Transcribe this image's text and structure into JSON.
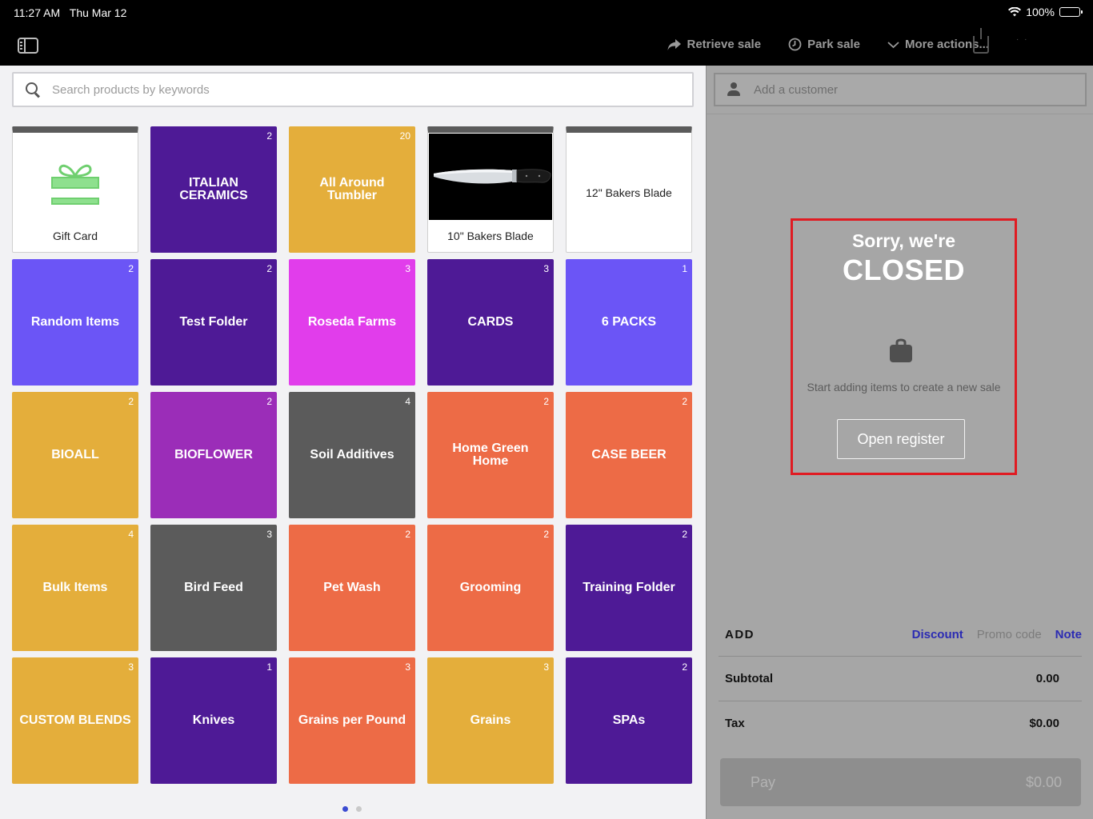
{
  "status_bar": {
    "time": "11:27 AM",
    "date": "Thu Mar 12",
    "battery": "100%"
  },
  "top_nav": {
    "retrieve_sale": "Retrieve sale",
    "park_sale": "Park sale",
    "more_actions": "More actions..."
  },
  "search": {
    "placeholder": "Search products by keywords"
  },
  "tiles": [
    {
      "label": "Gift Card",
      "type": "product",
      "icon": "gift-icon"
    },
    {
      "label": "ITALIAN CERAMICS",
      "count": "2",
      "color": "#4e1a96"
    },
    {
      "label": "All Around Tumbler",
      "count": "20",
      "color": "#e4ae3b"
    },
    {
      "label": "10\" Bakers Blade",
      "type": "product",
      "icon": "knife-image"
    },
    {
      "label": "12\" Bakers Blade",
      "type": "product"
    },
    {
      "label": "Random Items",
      "count": "2",
      "color": "#6b55f6"
    },
    {
      "label": "Test Folder",
      "count": "2",
      "color": "#4e1a96"
    },
    {
      "label": "Roseda Farms",
      "count": "3",
      "color": "#e13deb"
    },
    {
      "label": "CARDS",
      "count": "3",
      "color": "#4e1a96"
    },
    {
      "label": "6 PACKS",
      "count": "1",
      "color": "#6b55f6"
    },
    {
      "label": "BIOALL",
      "count": "2",
      "color": "#e4ae3b"
    },
    {
      "label": "BIOFLOWER",
      "count": "2",
      "color": "#9b2db8"
    },
    {
      "label": "Soil Additives",
      "count": "4",
      "color": "#5b5b5b"
    },
    {
      "label": "Home Green Home",
      "count": "2",
      "color": "#ed6b46"
    },
    {
      "label": "CASE BEER",
      "count": "2",
      "color": "#ed6b46"
    },
    {
      "label": "Bulk Items",
      "count": "4",
      "color": "#e4ae3b"
    },
    {
      "label": "Bird Feed",
      "count": "3",
      "color": "#5b5b5b"
    },
    {
      "label": "Pet Wash",
      "count": "2",
      "color": "#ed6b46"
    },
    {
      "label": "Grooming",
      "count": "2",
      "color": "#ed6b46"
    },
    {
      "label": "Training Folder",
      "count": "2",
      "color": "#4e1a96"
    },
    {
      "label": "CUSTOM BLENDS",
      "count": "3",
      "color": "#e4ae3b"
    },
    {
      "label": "Knives",
      "count": "1",
      "color": "#4e1a96"
    },
    {
      "label": "Grains per Pound",
      "count": "3",
      "color": "#ed6b46"
    },
    {
      "label": "Grains",
      "count": "3",
      "color": "#e4ae3b"
    },
    {
      "label": "SPAs",
      "count": "2",
      "color": "#4e1a96"
    }
  ],
  "pager": {
    "current": 1,
    "total": 2
  },
  "sale_panel": {
    "customer_placeholder": "Add a customer",
    "closed_title": "Sorry, we're",
    "closed_status": "CLOSED",
    "hint": "Start adding items to create a new sale",
    "open_register": "Open register",
    "add_label": "ADD",
    "discount": "Discount",
    "promo_code": "Promo code",
    "note": "Note",
    "subtotal_label": "Subtotal",
    "subtotal_value": "0.00",
    "tax_label": "Tax",
    "tax_value": "$0.00",
    "pay_label": "Pay",
    "pay_amount": "$0.00"
  },
  "colors": {
    "closed_highlight": "#e01b22",
    "link": "#2b2bb3"
  }
}
